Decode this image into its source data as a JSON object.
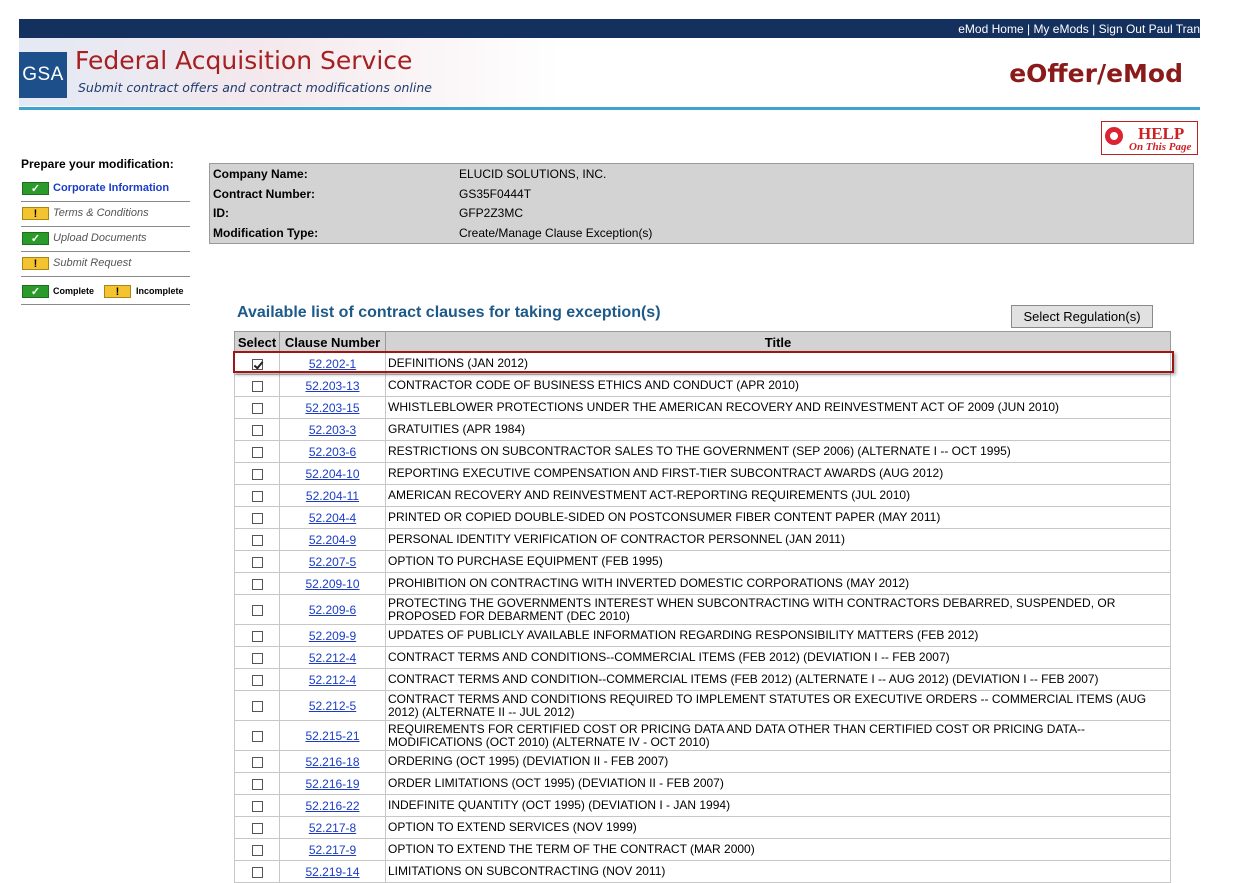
{
  "topnav": {
    "emod_home": "eMod Home",
    "my_emods": "My eMods",
    "sign_out": "Sign Out Paul Tran",
    "separator": "|"
  },
  "header": {
    "logo_text": "GSA",
    "title": "Federal Acquisition Service",
    "subtitle": "Submit contract offers and contract modifications online",
    "app_name": "eOffer/eMod"
  },
  "help": {
    "line1": "HELP",
    "line2": "On This Page"
  },
  "sidebar": {
    "heading": "Prepare your modification:",
    "items": [
      {
        "label": "Corporate Information",
        "status": "complete",
        "badge": "✓"
      },
      {
        "label": "Terms & Conditions",
        "status": "incomplete",
        "badge": "!"
      },
      {
        "label": "Upload Documents",
        "status": "complete",
        "badge": "✓"
      },
      {
        "label": "Submit Request",
        "status": "incomplete",
        "badge": "!"
      }
    ],
    "legend": {
      "complete": "Complete",
      "incomplete": "Incomplete",
      "ok_badge": "✓",
      "warn_badge": "!"
    }
  },
  "info": [
    {
      "label": "Company Name:",
      "value": "ELUCID SOLUTIONS, INC."
    },
    {
      "label": "Contract Number:",
      "value": "GS35F0444T"
    },
    {
      "label": "ID:",
      "value": "GFP2Z3MC"
    },
    {
      "label": "Modification Type:",
      "value": "Create/Manage Clause Exception(s)"
    }
  ],
  "clauses": {
    "section_title": "Available list of contract clauses for taking exception(s)",
    "select_regulation_label": "Select Regulation(s)",
    "headers": {
      "select": "Select",
      "number": "Clause Number",
      "title": "Title"
    },
    "rows": [
      {
        "number": "52.202-1",
        "title": "DEFINITIONS (JAN 2012)",
        "checked": true,
        "tall": false
      },
      {
        "number": "52.203-13",
        "title": "CONTRACTOR CODE OF BUSINESS ETHICS AND CONDUCT (APR 2010)",
        "checked": false,
        "tall": false
      },
      {
        "number": "52.203-15",
        "title": "WHISTLEBLOWER PROTECTIONS UNDER THE AMERICAN RECOVERY AND REINVESTMENT ACT OF 2009 (JUN 2010)",
        "checked": false,
        "tall": false
      },
      {
        "number": "52.203-3",
        "title": "GRATUITIES (APR 1984)",
        "checked": false,
        "tall": false
      },
      {
        "number": "52.203-6",
        "title": "RESTRICTIONS ON SUBCONTRACTOR SALES TO THE GOVERNMENT (SEP 2006) (ALTERNATE I -- OCT 1995)",
        "checked": false,
        "tall": false
      },
      {
        "number": "52.204-10",
        "title": "REPORTING EXECUTIVE COMPENSATION AND FIRST-TIER SUBCONTRACT AWARDS (AUG 2012)",
        "checked": false,
        "tall": false
      },
      {
        "number": "52.204-11",
        "title": "AMERICAN RECOVERY AND REINVESTMENT ACT-REPORTING REQUIREMENTS (JUL 2010)",
        "checked": false,
        "tall": false
      },
      {
        "number": "52.204-4",
        "title": "PRINTED OR COPIED DOUBLE-SIDED ON POSTCONSUMER FIBER CONTENT PAPER (MAY 2011)",
        "checked": false,
        "tall": false
      },
      {
        "number": "52.204-9",
        "title": "PERSONAL IDENTITY VERIFICATION OF CONTRACTOR PERSONNEL (JAN 2011)",
        "checked": false,
        "tall": false
      },
      {
        "number": "52.207-5",
        "title": "OPTION TO PURCHASE EQUIPMENT (FEB 1995)",
        "checked": false,
        "tall": false
      },
      {
        "number": "52.209-10",
        "title": "PROHIBITION ON CONTRACTING WITH INVERTED DOMESTIC CORPORATIONS (MAY 2012)",
        "checked": false,
        "tall": false
      },
      {
        "number": "52.209-6",
        "title": "PROTECTING THE GOVERNMENTS INTEREST WHEN SUBCONTRACTING WITH CONTRACTORS DEBARRED, SUSPENDED, OR PROPOSED FOR DEBARMENT (DEC 2010)",
        "checked": false,
        "tall": true
      },
      {
        "number": "52.209-9",
        "title": "UPDATES OF PUBLICLY AVAILABLE INFORMATION REGARDING RESPONSIBILITY MATTERS (FEB 2012)",
        "checked": false,
        "tall": false
      },
      {
        "number": "52.212-4",
        "title": "CONTRACT TERMS AND CONDITIONS--COMMERCIAL ITEMS (FEB 2012) (DEVIATION I -- FEB 2007)",
        "checked": false,
        "tall": false
      },
      {
        "number": "52.212-4",
        "title": "CONTRACT TERMS AND CONDITION--COMMERCIAL ITEMS (FEB 2012) (ALTERNATE I -- AUG 2012) (DEVIATION I -- FEB 2007)",
        "checked": false,
        "tall": false
      },
      {
        "number": "52.212-5",
        "title": "CONTRACT TERMS AND CONDITIONS REQUIRED TO IMPLEMENT STATUTES OR EXECUTIVE ORDERS -- COMMERCIAL ITEMS (AUG 2012) (ALTERNATE II -- JUL 2012)",
        "checked": false,
        "tall": true
      },
      {
        "number": "52.215-21",
        "title": "REQUIREMENTS FOR CERTIFIED COST OR PRICING DATA AND DATA OTHER THAN CERTIFIED COST OR PRICING DATA--MODIFICATIONS (OCT 2010) (ALTERNATE IV - OCT 2010)",
        "checked": false,
        "tall": true
      },
      {
        "number": "52.216-18",
        "title": "ORDERING (OCT 1995) (DEVIATION II - FEB 2007)",
        "checked": false,
        "tall": false
      },
      {
        "number": "52.216-19",
        "title": "ORDER LIMITATIONS (OCT 1995) (DEVIATION II - FEB 2007)",
        "checked": false,
        "tall": false
      },
      {
        "number": "52.216-22",
        "title": "INDEFINITE QUANTITY (OCT 1995) (DEVIATION I - JAN 1994)",
        "checked": false,
        "tall": false
      },
      {
        "number": "52.217-8",
        "title": "OPTION TO EXTEND SERVICES (NOV 1999)",
        "checked": false,
        "tall": false
      },
      {
        "number": "52.217-9",
        "title": "OPTION TO EXTEND THE TERM OF THE CONTRACT (MAR 2000)",
        "checked": false,
        "tall": false
      },
      {
        "number": "52.219-14",
        "title": "LIMITATIONS ON SUBCONTRACTING (NOV 2011)",
        "checked": false,
        "tall": false
      }
    ]
  },
  "colors": {
    "topbar": "#14305e",
    "accent_red": "#8b1a1a",
    "link_blue": "#1a3cc8",
    "section_title": "#1d5a8a",
    "complete_green": "#2a9a2a",
    "incomplete_yellow": "#f4c430"
  }
}
